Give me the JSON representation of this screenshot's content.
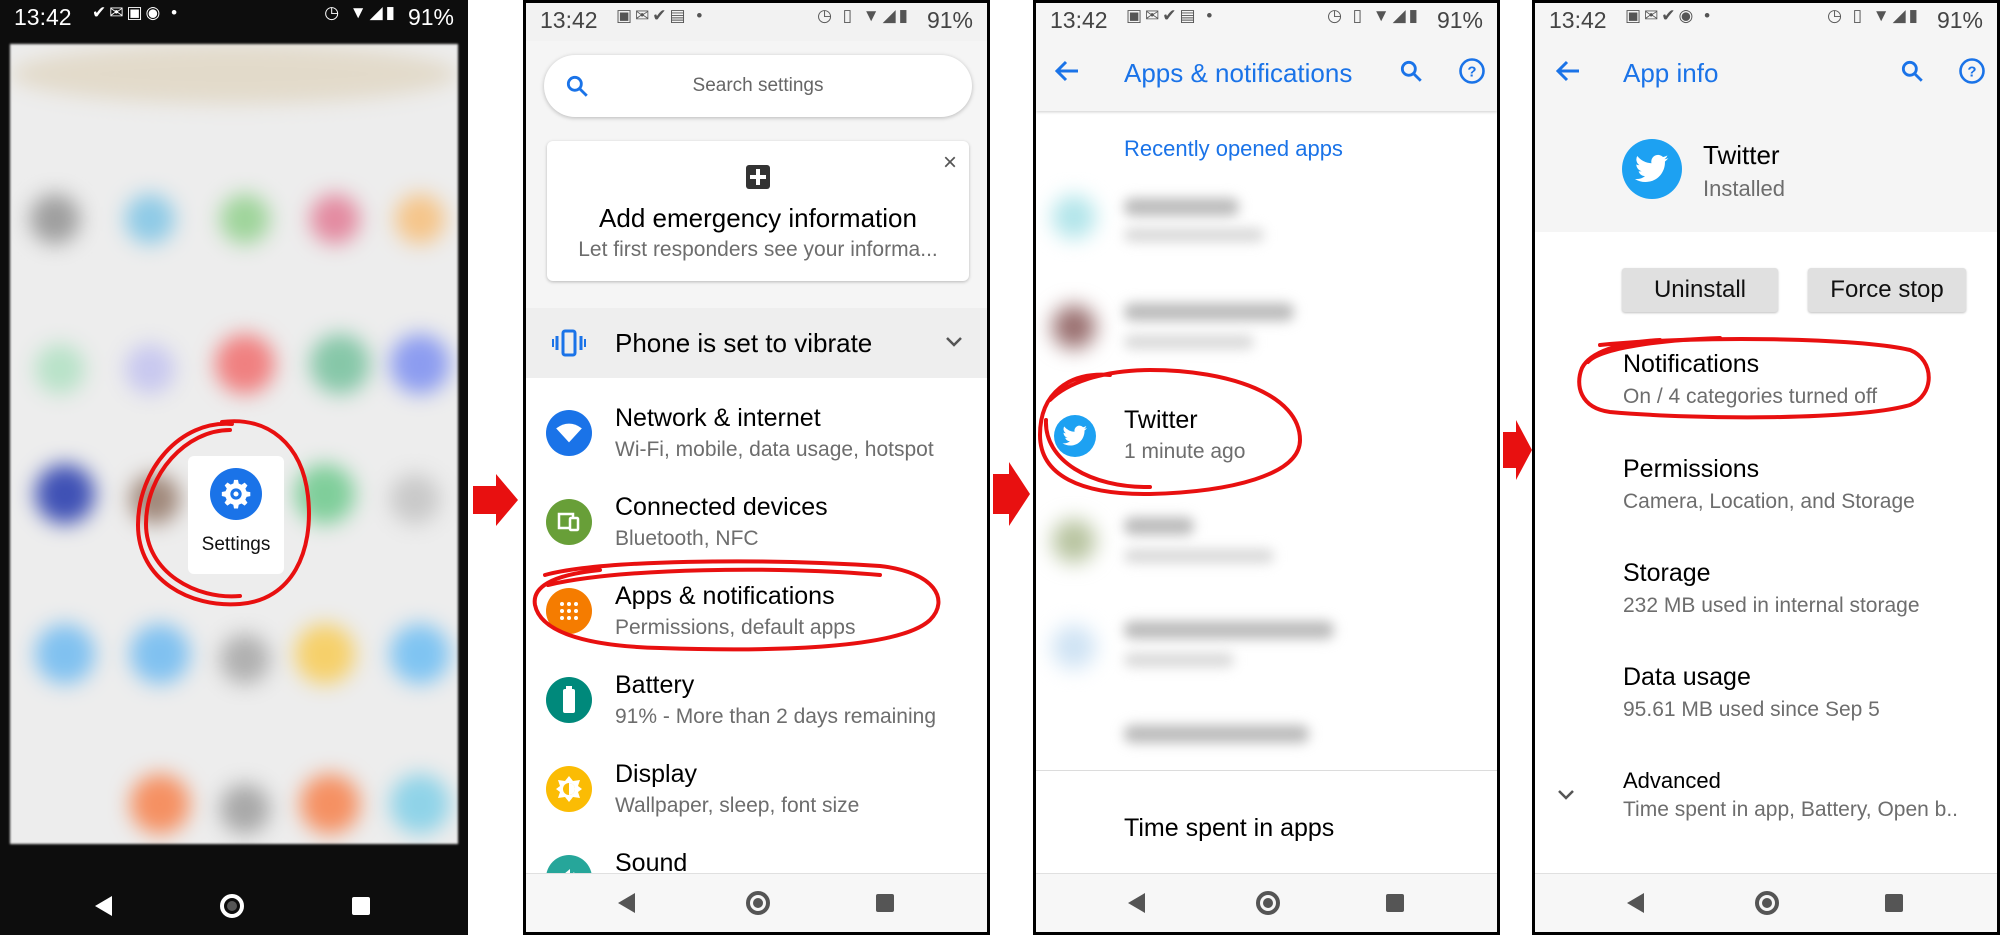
{
  "status": {
    "time": "13:42",
    "battery": "91%"
  },
  "panel1": {
    "settings_label": "Settings"
  },
  "panel2": {
    "search_placeholder": "Search settings",
    "emergency_title": "Add emergency information",
    "emergency_subtitle": "Let first responders see your informa...",
    "vibrate_label": "Phone is set to vibrate",
    "items": [
      {
        "title": "Network & internet",
        "subtitle": "Wi-Fi, mobile, data usage, hotspot",
        "color": "#1a73e8"
      },
      {
        "title": "Connected devices",
        "subtitle": "Bluetooth, NFC",
        "color": "#689f38"
      },
      {
        "title": "Apps & notifications",
        "subtitle": "Permissions, default apps",
        "color": "#f57c00"
      },
      {
        "title": "Battery",
        "subtitle": "91% - More than 2 days remaining",
        "color": "#00897b"
      },
      {
        "title": "Display",
        "subtitle": "Wallpaper, sleep, font size",
        "color": "#fbbc04"
      },
      {
        "title": "Sound",
        "subtitle": "",
        "color": "#26a69a"
      }
    ]
  },
  "panel3": {
    "title": "Apps & notifications",
    "recent_header": "Recently opened apps",
    "twitter_name": "Twitter",
    "twitter_time": "1 minute ago",
    "time_spent": "Time spent in apps"
  },
  "panel4": {
    "title": "App info",
    "app_name": "Twitter",
    "app_status": "Installed",
    "uninstall": "Uninstall",
    "force_stop": "Force stop",
    "items": [
      {
        "title": "Notifications",
        "subtitle": "On / 4 categories turned off"
      },
      {
        "title": "Permissions",
        "subtitle": "Camera, Location, and Storage"
      },
      {
        "title": "Storage",
        "subtitle": "232 MB used in internal storage"
      },
      {
        "title": "Data usage",
        "subtitle": "95.61 MB used since Sep 5"
      }
    ],
    "advanced_title": "Advanced",
    "advanced_subtitle": "Time spent in app, Battery, Open b.."
  },
  "colors": {
    "accent": "#1a73e8",
    "annotation": "#e81010",
    "twitter": "#1da1f2"
  }
}
